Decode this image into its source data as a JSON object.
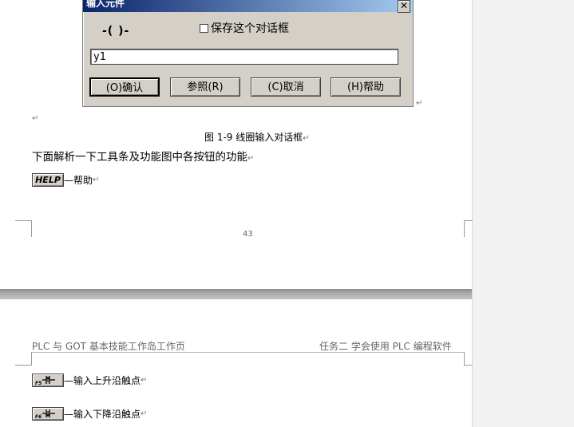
{
  "dialog": {
    "title": "输入元件",
    "close_label": "✕",
    "coil_symbol": "-( )-",
    "save_checkbox_label": "保存这个对话框",
    "input_value": "y1",
    "buttons": {
      "ok": "(O)确认",
      "browse": "参照(R)",
      "cancel": "(C)取消",
      "help": "(H)帮助"
    }
  },
  "doc": {
    "caption": "图 1-9  线圈输入对话框",
    "paragraph": "下面解析一下工具条及功能图中各按钮的功能",
    "help_icon_label": "HELP",
    "help_desc": "—帮助",
    "page_number": "43",
    "header_left": "PLC 与 GOT 基本技能工作岛工作页",
    "header_right": "任务二    学会使用 PLC 编程软件",
    "rise_icon_label": "F5",
    "rise_desc": "—输入上升沿触点",
    "fall_icon_label": "F6",
    "fall_desc": "—输入下降沿触点",
    "return_mark": "↵"
  }
}
